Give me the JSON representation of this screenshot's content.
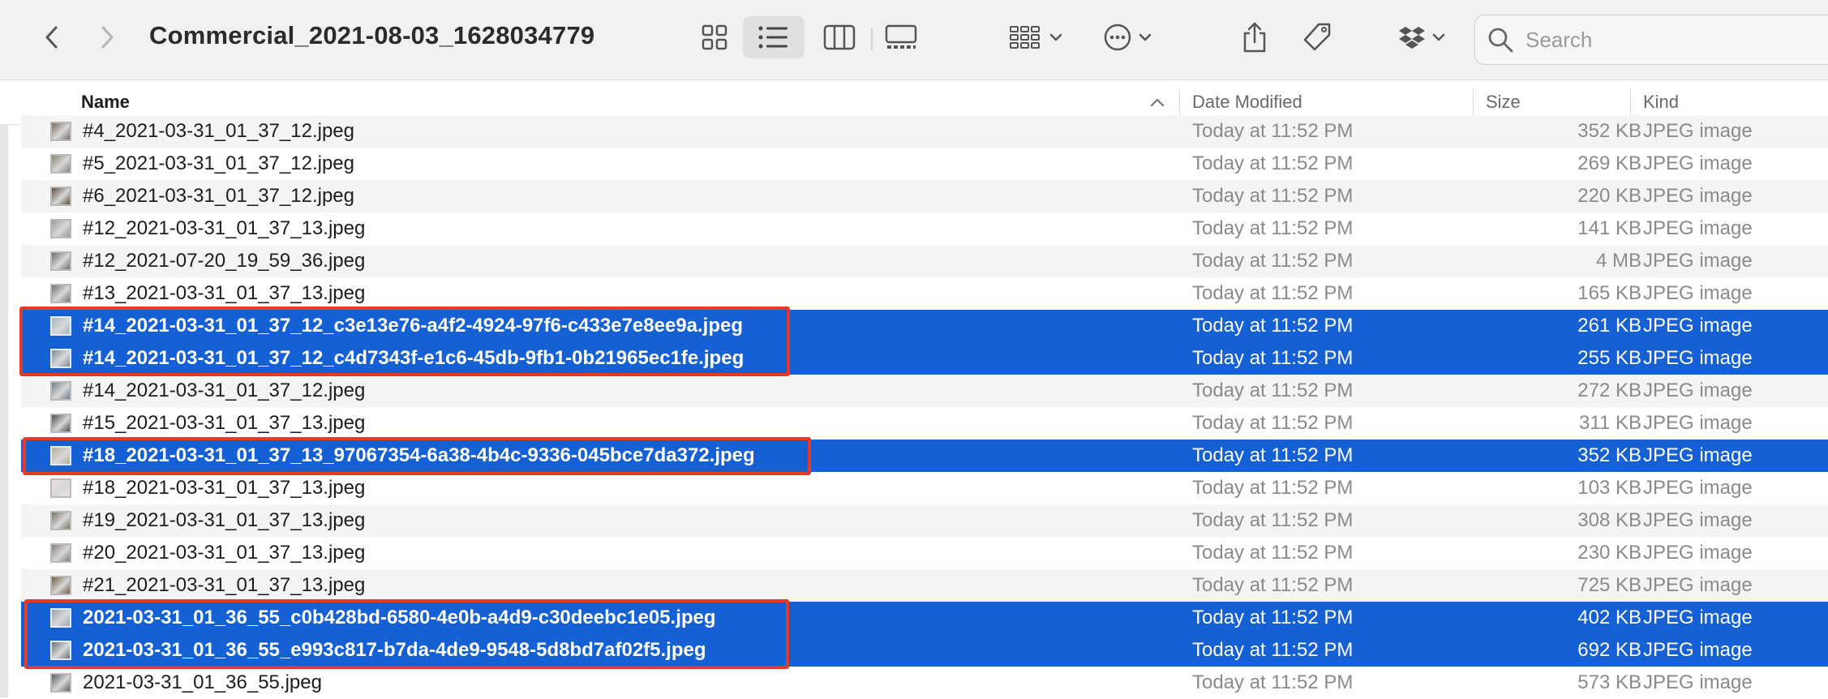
{
  "window": {
    "title": "Commercial_2021-08-03_1628034779",
    "accent_color": "#1660d6",
    "highlight_color": "#e23b2a"
  },
  "toolbar": {
    "back_icon": "chevron-left-icon",
    "forward_icon": "chevron-right-icon",
    "view_icons": [
      "grid-icon",
      "list-icon",
      "columns-icon",
      "gallery-icon"
    ],
    "group_icon": "group-grid-icon",
    "more_icon": "ellipsis-circle-icon",
    "share_icon": "share-icon",
    "tag_icon": "tag-icon",
    "dropbox_icon": "dropbox-icon",
    "search_placeholder": "Search"
  },
  "columns": {
    "name": "Name",
    "date": "Date Modified",
    "size": "Size",
    "kind": "Kind"
  },
  "files": [
    {
      "name": "#4_2021-03-31_01_37_12.jpeg",
      "date": "Today at 11:52 PM",
      "size": "352 KB",
      "kind": "JPEG image",
      "selected": false,
      "thumb": "#7a6a62"
    },
    {
      "name": "#5_2021-03-31_01_37_12.jpeg",
      "date": "Today at 11:52 PM",
      "size": "269 KB",
      "kind": "JPEG image",
      "selected": false,
      "thumb": "#8a8278"
    },
    {
      "name": "#6_2021-03-31_01_37_12.jpeg",
      "date": "Today at 11:52 PM",
      "size": "220 KB",
      "kind": "JPEG image",
      "selected": false,
      "thumb": "#5e4f3f"
    },
    {
      "name": "#12_2021-03-31_01_37_13.jpeg",
      "date": "Today at 11:52 PM",
      "size": "141 KB",
      "kind": "JPEG image",
      "selected": false,
      "thumb": "#9a9a9a"
    },
    {
      "name": "#12_2021-07-20_19_59_36.jpeg",
      "date": "Today at 11:52 PM",
      "size": "4 MB",
      "kind": "JPEG image",
      "selected": false,
      "thumb": "#6e6e6e"
    },
    {
      "name": "#13_2021-03-31_01_37_13.jpeg",
      "date": "Today at 11:52 PM",
      "size": "165 KB",
      "kind": "JPEG image",
      "selected": false,
      "thumb": "#707070"
    },
    {
      "name": "#14_2021-03-31_01_37_12_c3e13e76-a4f2-4924-97f6-c433e7e8ee9a.jpeg",
      "date": "Today at 11:52 PM",
      "size": "261 KB",
      "kind": "JPEG image",
      "selected": true,
      "thumb": "#a9b4c2"
    },
    {
      "name": "#14_2021-03-31_01_37_12_c4d7343f-e1c6-45db-9fb1-0b21965ec1fe.jpeg",
      "date": "Today at 11:52 PM",
      "size": "255 KB",
      "kind": "JPEG image",
      "selected": true,
      "thumb": "#7d8a99"
    },
    {
      "name": "#14_2021-03-31_01_37_12.jpeg",
      "date": "Today at 11:52 PM",
      "size": "272 KB",
      "kind": "JPEG image",
      "selected": false,
      "thumb": "#6f7c8a"
    },
    {
      "name": "#15_2021-03-31_01_37_13.jpeg",
      "date": "Today at 11:52 PM",
      "size": "311 KB",
      "kind": "JPEG image",
      "selected": false,
      "thumb": "#4c4a44"
    },
    {
      "name": "#18_2021-03-31_01_37_13_97067354-6a38-4b4c-9336-045bce7da372.jpeg",
      "date": "Today at 11:52 PM",
      "size": "352 KB",
      "kind": "JPEG image",
      "selected": true,
      "thumb": "#b8aa98"
    },
    {
      "name": "#18_2021-03-31_01_37_13.jpeg",
      "date": "Today at 11:52 PM",
      "size": "103 KB",
      "kind": "JPEG image",
      "selected": false,
      "thumb": "#f2dede"
    },
    {
      "name": "#19_2021-03-31_01_37_13.jpeg",
      "date": "Today at 11:52 PM",
      "size": "308 KB",
      "kind": "JPEG image",
      "selected": false,
      "thumb": "#7b7466"
    },
    {
      "name": "#20_2021-03-31_01_37_13.jpeg",
      "date": "Today at 11:52 PM",
      "size": "230 KB",
      "kind": "JPEG image",
      "selected": false,
      "thumb": "#857f77"
    },
    {
      "name": "#21_2021-03-31_01_37_13.jpeg",
      "date": "Today at 11:52 PM",
      "size": "725 KB",
      "kind": "JPEG image",
      "selected": false,
      "thumb": "#6d5a40"
    },
    {
      "name": "2021-03-31_01_36_55_c0b428bd-6580-4e0b-a4d9-c30deebc1e05.jpeg",
      "date": "Today at 11:52 PM",
      "size": "402 KB",
      "kind": "JPEG image",
      "selected": true,
      "thumb": "#9aa3ad"
    },
    {
      "name": "2021-03-31_01_36_55_e993c817-b7da-4de9-9548-5d8bd7af02f5.jpeg",
      "date": "Today at 11:52 PM",
      "size": "692 KB",
      "kind": "JPEG image",
      "selected": true,
      "thumb": "#6b7178"
    },
    {
      "name": "2021-03-31_01_36_55.jpeg",
      "date": "Today at 11:52 PM",
      "size": "573 KB",
      "kind": "JPEG image",
      "selected": false,
      "thumb": "#5a6066"
    }
  ]
}
